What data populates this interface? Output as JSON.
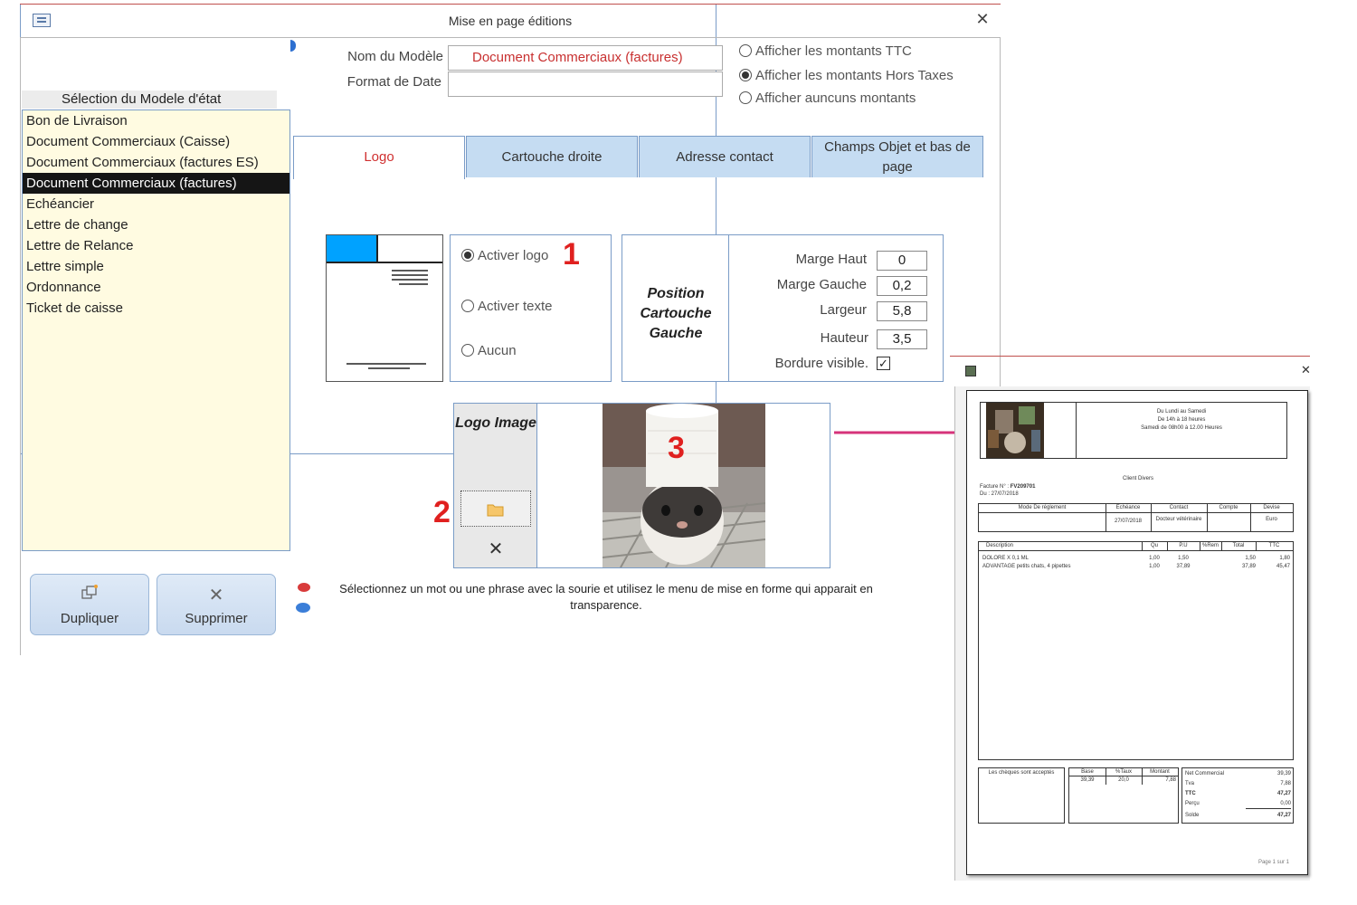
{
  "window": {
    "title": "Mise en page éditions",
    "close": "✕"
  },
  "left_panel": {
    "header": "Sélection du Modele d'état",
    "items": [
      "Bon de Livraison",
      "Document Commerciaux (Caisse)",
      "Document Commerciaux (factures ES)",
      "Document Commerciaux (factures)",
      "Echéancier",
      "Lettre de change",
      "Lettre de Relance",
      "Lettre simple",
      "Ordonnance",
      "Ticket de caisse"
    ],
    "selected_index": 3,
    "duplicate_label": "Dupliquer",
    "delete_label": "Supprimer"
  },
  "form": {
    "model_name_label": "Nom du Modèle",
    "model_name_value": "Document Commerciaux (factures)",
    "date_format_label": "Format de Date",
    "date_format_value": "",
    "amount_options": [
      {
        "label": "Afficher les montants TTC",
        "checked": false
      },
      {
        "label": "Afficher les montants Hors Taxes",
        "checked": true
      },
      {
        "label": "Afficher auncuns montants",
        "checked": false
      }
    ]
  },
  "tabs": [
    {
      "label": "Logo",
      "active": true
    },
    {
      "label": "Cartouche droite",
      "active": false
    },
    {
      "label": "Adresse contact",
      "active": false
    },
    {
      "label": "Champs Objet et bas de page",
      "active": false
    }
  ],
  "logo_tab": {
    "options": [
      {
        "label": "Activer logo",
        "checked": true
      },
      {
        "label": "Activer texte",
        "checked": false
      },
      {
        "label": "Aucun",
        "checked": false
      }
    ],
    "position_title": "Position Cartouche Gauche",
    "fields": [
      {
        "label": "Marge Haut",
        "value": "0"
      },
      {
        "label": "Marge Gauche",
        "value": "0,2"
      },
      {
        "label": "Largeur",
        "value": "5,8"
      },
      {
        "label": "Hauteur",
        "value": "3,5"
      }
    ],
    "border_label": "Bordure visible.",
    "border_checked": true,
    "logo_image_label": "Logo Image",
    "annotation_1": "1",
    "annotation_2": "2",
    "annotation_3": "3",
    "hint": "Sélectionnez un mot ou une phrase avec la sourie et utilisez le menu de mise en forme qui apparait en transparence."
  },
  "preview": {
    "close": "✕",
    "hours_1": "Du Lundi au Samedi",
    "hours_2": "De 14h à 18 heures",
    "hours_3": "Samedi de 08h00 à 12.00 Heures",
    "client": "Client Divers",
    "invoice_label": "Facture N° :",
    "invoice_number": "FV209701",
    "date_line": "Du : 27/07/2018",
    "table1_headers": [
      "Mode De réglement",
      "Echéance",
      "Contact",
      "Compte",
      "Devise"
    ],
    "table1_row": [
      "",
      "27/07/2018",
      "Docteur vétérinaire",
      "",
      "Euro"
    ],
    "table2_headers": [
      "Description",
      "Qu",
      "P.U",
      "%Rem",
      "Total",
      "TTC"
    ],
    "table2_rows": [
      [
        "DOLORE X 0,1 ML",
        "1,00",
        "1,50",
        "",
        "1,50",
        "1,80"
      ],
      [
        "ADVANTAGE petits chats, 4 pipettes",
        "1,00",
        "37,89",
        "",
        "37,89",
        "45,47"
      ]
    ],
    "cheques_note": "Les chèques sont acceptés",
    "vat_headers": [
      "Base",
      "%Taux",
      "Montant"
    ],
    "vat_row": [
      "39,39",
      "20,0",
      "7,88"
    ],
    "totals": [
      {
        "label": "Net Commercial",
        "value": "39,39"
      },
      {
        "label": "Tva",
        "value": "7,88"
      },
      {
        "label": "TTC",
        "value": "47,27"
      },
      {
        "label": "Perçu",
        "value": "0,00"
      },
      {
        "label": "Solde",
        "value": "47,27"
      }
    ],
    "page_footer": "Page 1 sur 1"
  },
  "colors": {
    "accent_red": "#e0201f",
    "tab_blue": "#c5dcf2",
    "list_bg": "#fffbe1",
    "arrow": "#d6337a"
  }
}
